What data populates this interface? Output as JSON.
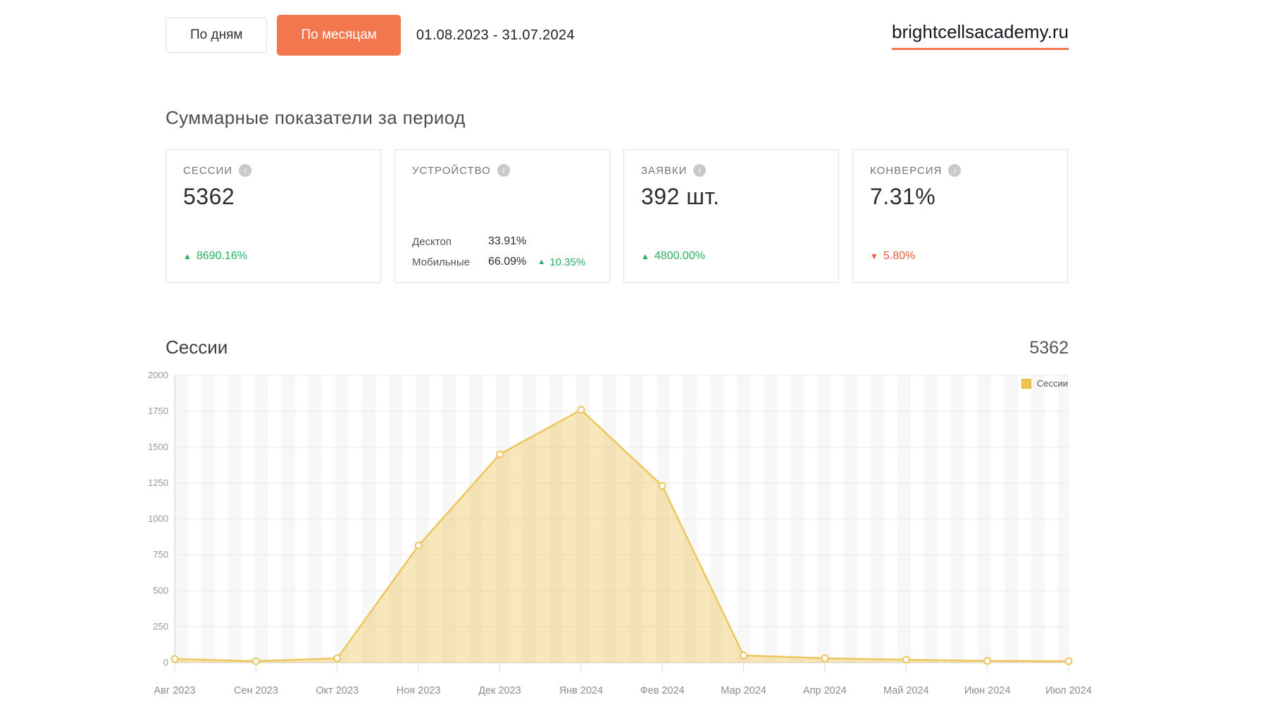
{
  "header": {
    "view_by_days": "По дням",
    "view_by_months": "По месяцам",
    "date_range": "01.08.2023 - 31.07.2024",
    "site_domain": "brightcellsacademy.ru"
  },
  "summary": {
    "section_title": "Суммарные показатели за период",
    "info_icon_glyph": "i",
    "cards": [
      {
        "label": "СЕССИИ",
        "value": "5362",
        "change": {
          "arrow": "▲",
          "percent": "8690.16%",
          "direction": "up"
        }
      },
      {
        "label": "УСТРОЙСТВО",
        "rows": [
          {
            "name": "Десктоп",
            "value": "33.91%"
          },
          {
            "name": "Мобильные",
            "value": "66.09%",
            "change": {
              "arrow": "▲",
              "percent": "10.35%",
              "direction": "up"
            }
          }
        ]
      },
      {
        "label": "ЗАЯВКИ",
        "value": "392 шт.",
        "change": {
          "arrow": "▲",
          "percent": "4800.00%",
          "direction": "up"
        }
      },
      {
        "label": "КОНВЕРСИЯ",
        "value": "7.31%",
        "change": {
          "arrow": "▼",
          "percent": "5.80%",
          "direction": "down"
        }
      }
    ]
  },
  "chart_section": {
    "title": "Сессии",
    "total": "5362",
    "legend_label": "Сессии"
  },
  "chart_data": {
    "type": "area",
    "title": "Сессии",
    "x": [
      "Авг 2023",
      "Сен 2023",
      "Окт 2023",
      "Ноя 2023",
      "Дек 2023",
      "Янв 2024",
      "Фев 2024",
      "Мар 2024",
      "Апр 2024",
      "Май 2024",
      "Июн 2024",
      "Июл 2024"
    ],
    "series": [
      {
        "name": "Сессии",
        "values": [
          25,
          10,
          30,
          815,
          1450,
          1760,
          1230,
          50,
          30,
          20,
          12,
          10
        ]
      }
    ],
    "ylim": [
      0,
      2000
    ],
    "yticks": [
      0,
      250,
      500,
      750,
      1000,
      1250,
      1500,
      1750,
      2000
    ],
    "grid": true,
    "legend_position": "top-right"
  },
  "colors": {
    "accent_orange": "#F2774D",
    "positive_green": "#27AE60",
    "negative_red": "#EA5B3C",
    "series_line": "#EFC55D",
    "series_fill": "rgba(239,197,93,0.42)",
    "grid_line": "#e9e9e9",
    "axis_line": "#cccccc",
    "tick_line": "#dddddd",
    "stripe": "#f7f7f7",
    "axis_text": "#979797"
  }
}
